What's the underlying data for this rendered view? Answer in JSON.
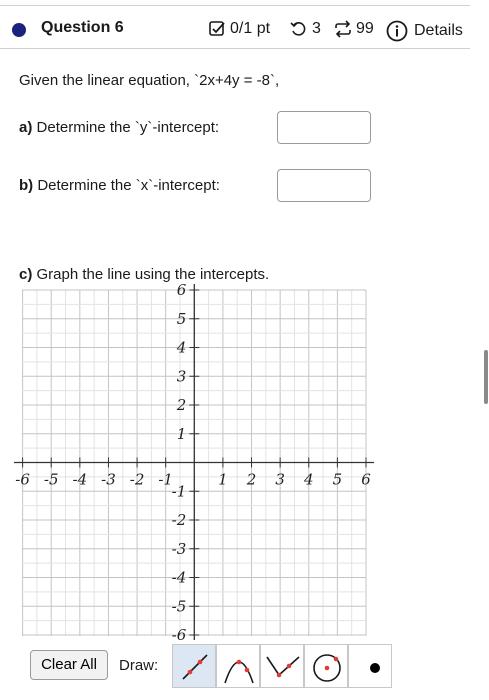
{
  "header": {
    "question_title": "Question 6",
    "score": "0/1 pt",
    "retries": "3",
    "attempts": "99",
    "details": "Details"
  },
  "prompt": "Given the linear equation, `2x+4y = -8`,",
  "part_a": {
    "label": "a)",
    "text": "Determine the `y`-intercept:",
    "value": ""
  },
  "part_b": {
    "label": "b)",
    "text": "Determine the `x`-intercept:",
    "value": ""
  },
  "part_c": {
    "label": "c)",
    "text": "Graph the line using the intercepts."
  },
  "graph": {
    "x_ticks": [
      "-6",
      "-5",
      "-4",
      "-3",
      "-2",
      "-1",
      "1",
      "2",
      "3",
      "4",
      "5",
      "6"
    ],
    "y_ticks": [
      "6",
      "5",
      "4",
      "3",
      "2",
      "1",
      "-1",
      "-2",
      "-3",
      "-4",
      "-5",
      "-6"
    ],
    "xmin": -6,
    "xmax": 6,
    "ymin": -6,
    "ymax": 6,
    "grid_step": 0.5
  },
  "toolbar": {
    "clear_label": "Clear All",
    "draw_label": "Draw:",
    "tools": [
      "line-tool-icon",
      "parabola-tool-icon",
      "absolute-value-tool-icon",
      "circle-tool-icon",
      "point-tool-icon"
    ]
  },
  "colors": {
    "accent": "#1a237e",
    "tool_red": "#e53935",
    "active_tool_bg": "#dde6f3"
  }
}
